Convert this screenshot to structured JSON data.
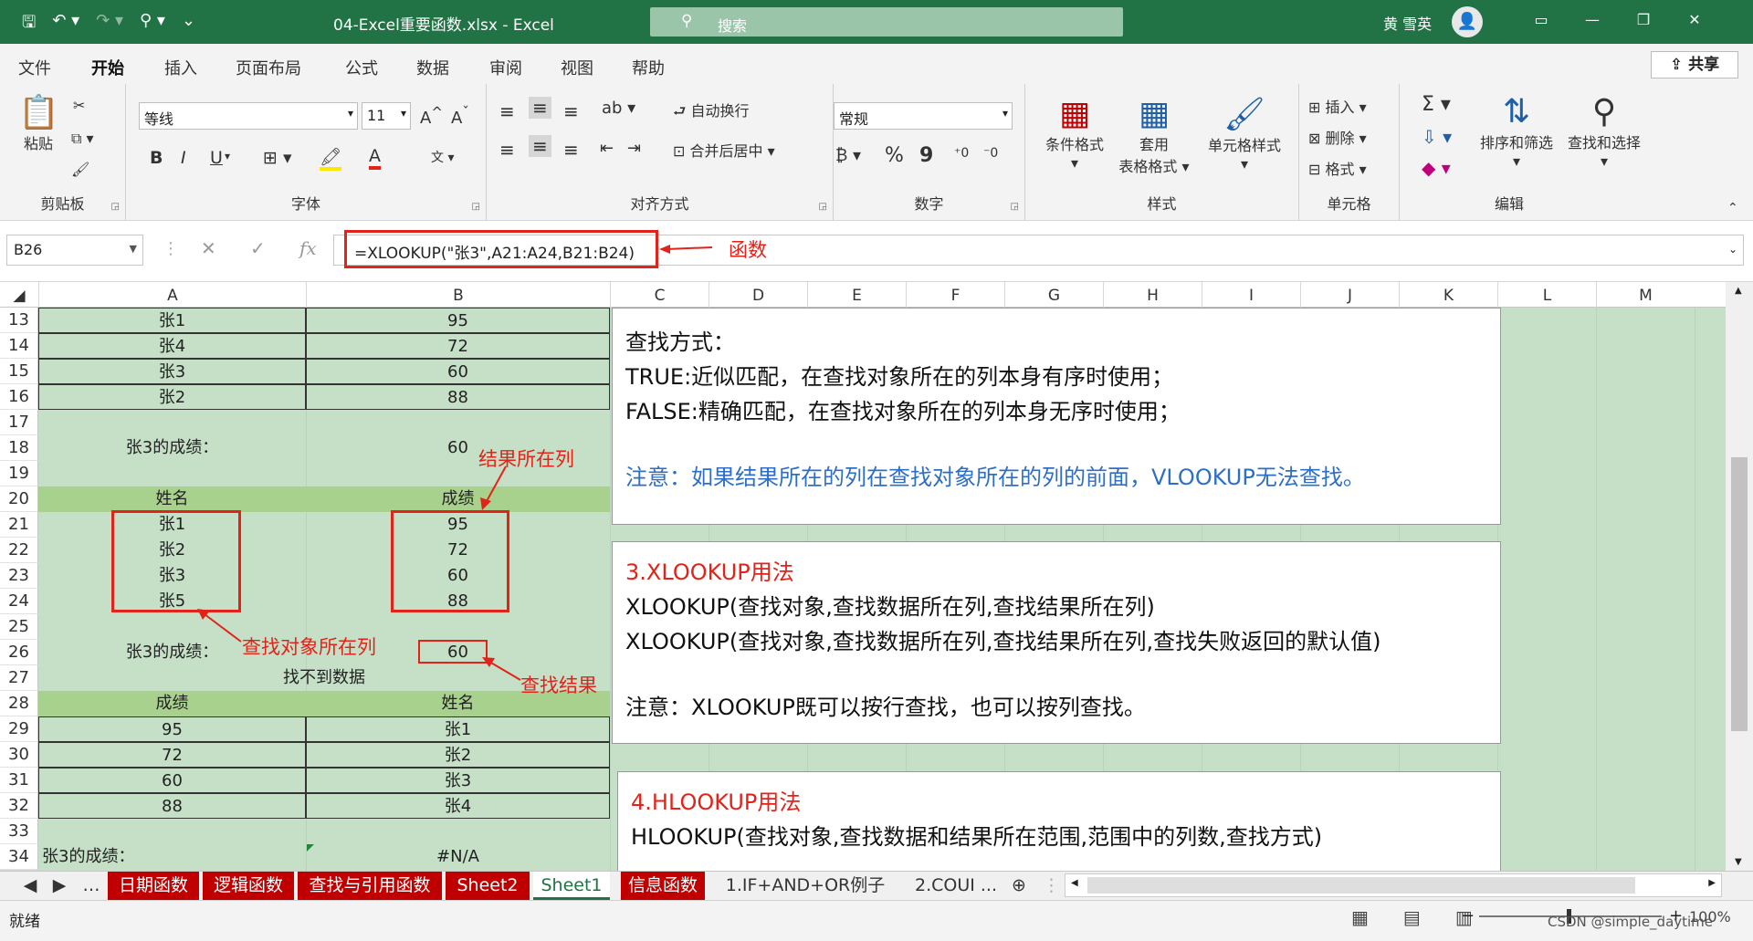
{
  "window": {
    "filename": "04-Excel重要函数.xlsx",
    "app": "Excel",
    "search_placeholder": "搜索",
    "user": "黄 雪英"
  },
  "tabs": [
    "文件",
    "开始",
    "插入",
    "页面布局",
    "公式",
    "数据",
    "审阅",
    "视图",
    "帮助"
  ],
  "active_tab": "开始",
  "share_label": "共享",
  "ribbon": {
    "clipboard": {
      "paste": "粘贴",
      "group": "剪贴板"
    },
    "font": {
      "name": "等线",
      "size": "11",
      "group": "字体",
      "bold": "B",
      "italic": "I",
      "underline": "U"
    },
    "alignment": {
      "wrap": "自动换行",
      "merge": "合并后居中",
      "group": "对齐方式"
    },
    "number": {
      "format": "常规",
      "group": "数字",
      "percent": "%",
      "comma": "9"
    },
    "styles": {
      "cond": "条件格式",
      "table1": "套用",
      "table2": "表格格式",
      "cell": "单元格样式",
      "group": "样式"
    },
    "cells": {
      "insert": "插入",
      "delete": "删除",
      "format": "格式",
      "group": "单元格"
    },
    "editing": {
      "sort": "排序和筛选",
      "find": "查找和选择",
      "group": "编辑"
    }
  },
  "formula_bar": {
    "name_box": "B26",
    "formula": "=XLOOKUP(\"张3\",A21:A24,B21:B24)",
    "annotation": "函数"
  },
  "columns": [
    "A",
    "B",
    "C",
    "D",
    "E",
    "F",
    "G",
    "H",
    "I",
    "J",
    "K",
    "L",
    "M"
  ],
  "rows": [
    "13",
    "14",
    "15",
    "16",
    "17",
    "18",
    "19",
    "20",
    "21",
    "22",
    "23",
    "24",
    "25",
    "26",
    "27",
    "28",
    "29",
    "30",
    "31",
    "32",
    "33",
    "34"
  ],
  "cells": {
    "r13": [
      "张1",
      "95"
    ],
    "r14": [
      "张4",
      "72"
    ],
    "r15": [
      "张3",
      "60"
    ],
    "r16": [
      "张2",
      "88"
    ],
    "r18": [
      "张3的成绩：",
      "60"
    ],
    "r20": [
      "姓名",
      "成绩"
    ],
    "r21": [
      "张1",
      "95"
    ],
    "r22": [
      "张2",
      "72"
    ],
    "r23": [
      "张3",
      "60"
    ],
    "r24": [
      "张5",
      "88"
    ],
    "r26": [
      "张3的成绩：",
      "60"
    ],
    "r27": "找不到数据",
    "r28": [
      "成绩",
      "姓名"
    ],
    "r29": [
      "95",
      "张1"
    ],
    "r30": [
      "72",
      "张2"
    ],
    "r31": [
      "60",
      "张3"
    ],
    "r32": [
      "88",
      "张4"
    ],
    "r34": [
      "张3的成绩：",
      "#N/A"
    ]
  },
  "annotations": {
    "result_col": "结果所在列",
    "lookup_col": "查找对象所在列",
    "result": "查找结果"
  },
  "textbox1": {
    "l1": "查找方式：",
    "l2": "TRUE:近似匹配，在查找对象所在的列本身有序时使用；",
    "l3": "FALSE:精确匹配，在查找对象所在的列本身无序时使用；",
    "l4": "注意：如果结果所在的列在查找对象所在的列的前面，VLOOKUP无法查找。"
  },
  "textbox2": {
    "title": "3.XLOOKUP用法",
    "l1": "XLOOKUP(查找对象,查找数据所在列,查找结果所在列)",
    "l2": "XLOOKUP(查找对象,查找数据所在列,查找结果所在列,查找失败返回的默认值)",
    "l3": "注意：XLOOKUP既可以按行查找，也可以按列查找。"
  },
  "textbox3": {
    "title": "4.HLOOKUP用法",
    "l1": "HLOOKUP(查找对象,查找数据和结果所在范围,范围中的列数,查找方式)"
  },
  "sheet_tabs": [
    {
      "label": "日期函数",
      "style": "red"
    },
    {
      "label": "逻辑函数",
      "style": "red"
    },
    {
      "label": "查找与引用函数",
      "style": "red"
    },
    {
      "label": "Sheet2",
      "style": "red"
    },
    {
      "label": "Sheet1",
      "style": "active"
    },
    {
      "label": "信息函数",
      "style": "red"
    },
    {
      "label": "1.IF+AND+OR例子",
      "style": "plain"
    },
    {
      "label": "2.COUI ...",
      "style": "plain"
    }
  ],
  "status": {
    "ready": "就绪",
    "zoom": "100%",
    "watermark": "CSDN @simple_daytime"
  },
  "colors": {
    "excel_green": "#217346",
    "annotation_red": "#e2231a",
    "sheet_bg": "#c6e0c8",
    "tab_red": "#c00000"
  }
}
